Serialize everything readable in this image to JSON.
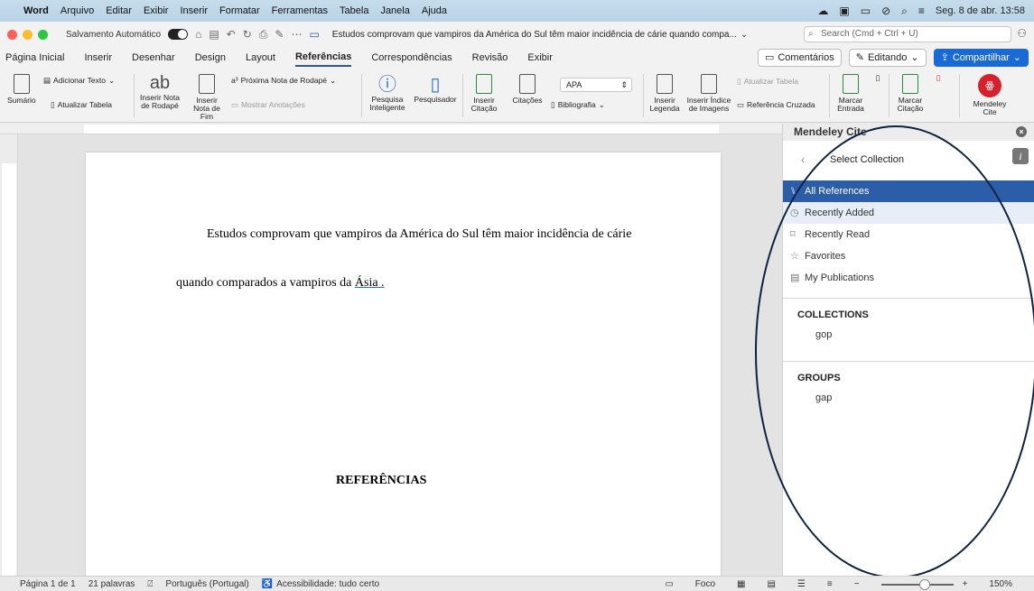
{
  "menubar": {
    "app": "Word",
    "items": [
      "Arquivo",
      "Editar",
      "Exibir",
      "Inserir",
      "Formatar",
      "Ferramentas",
      "Tabela",
      "Janela",
      "Ajuda"
    ],
    "datetime": "Seg. 8 de abr.  13:58"
  },
  "titlebar": {
    "autosave": "Salvamento Automático",
    "doc_title": "Estudos comprovam que vampiros da América do Sul têm maior incidência de cárie quando compa...",
    "search_placeholder": "Search (Cmd + Ctrl + U)"
  },
  "tabs": [
    "Página Inicial",
    "Inserir",
    "Desenhar",
    "Design",
    "Layout",
    "Referências",
    "Correspondências",
    "Revisão",
    "Exibir"
  ],
  "active_tab": 5,
  "tab_actions": {
    "comments": "Comentários",
    "editing": "Editando",
    "share": "Compartilhar"
  },
  "ribbon": {
    "sumario": "Sumário",
    "adicionar_texto": "Adicionar Texto",
    "atualizar_tabela": "Atualizar Tabela",
    "inserir_nota_rodape": "Inserir Nota de Rodapé",
    "inserir_nota_fim": "Inserir Nota de Fim",
    "proxima_nota": "Próxima Nota de Rodapé",
    "mostrar_anotacoes": "Mostrar Anotações",
    "pesquisa_inteligente": "Pesquisa Inteligente",
    "pesquisador": "Pesquisador",
    "inserir_citacao": "Inserir Citação",
    "citacoes": "Citações",
    "style": "APA",
    "bibliografia": "Bibliografia",
    "inserir_legenda": "Inserir Legenda",
    "inserir_indice_imagens": "Inserir Índice de Imagens",
    "atualizar_tabela2": "Atualizar Tabela",
    "referencia_cruzada": "Referência Cruzada",
    "marcar_entrada": "Marcar Entrada",
    "marcar_citacao": "Marcar Citação",
    "mendeley_cite": "Mendeley Cite"
  },
  "document": {
    "para1": "Estudos comprovam que vampiros da América do Sul têm maior incidência de cárie",
    "para2_text": "quando comparados a vampiros da ",
    "para2_cite": "Ásia .",
    "refs_heading": "REFERÊNCIAS"
  },
  "panel": {
    "title": "Mendeley Cite",
    "subtitle": "Select Collection",
    "items": [
      {
        "icon": "library-icon",
        "label": "All References"
      },
      {
        "icon": "clock-icon",
        "label": "Recently Added"
      },
      {
        "icon": "bookmark-icon",
        "label": "Recently Read"
      },
      {
        "icon": "star-icon",
        "label": "Favorites"
      },
      {
        "icon": "publications-icon",
        "label": "My Publications"
      }
    ],
    "collections_header": "COLLECTIONS",
    "collections": [
      "gop"
    ],
    "groups_header": "GROUPS",
    "groups": [
      "gap"
    ]
  },
  "status": {
    "page": "Página 1 de 1",
    "words": "21 palavras",
    "language": "Português (Portugal)",
    "accessibility": "Acessibilidade: tudo certo",
    "focus": "Foco",
    "zoom": "150%",
    "zoom_fraction": 0.6
  },
  "colors": {
    "selection": "#2b5da8",
    "share": "#1a6ad6",
    "mendeley": "#d6202c"
  }
}
